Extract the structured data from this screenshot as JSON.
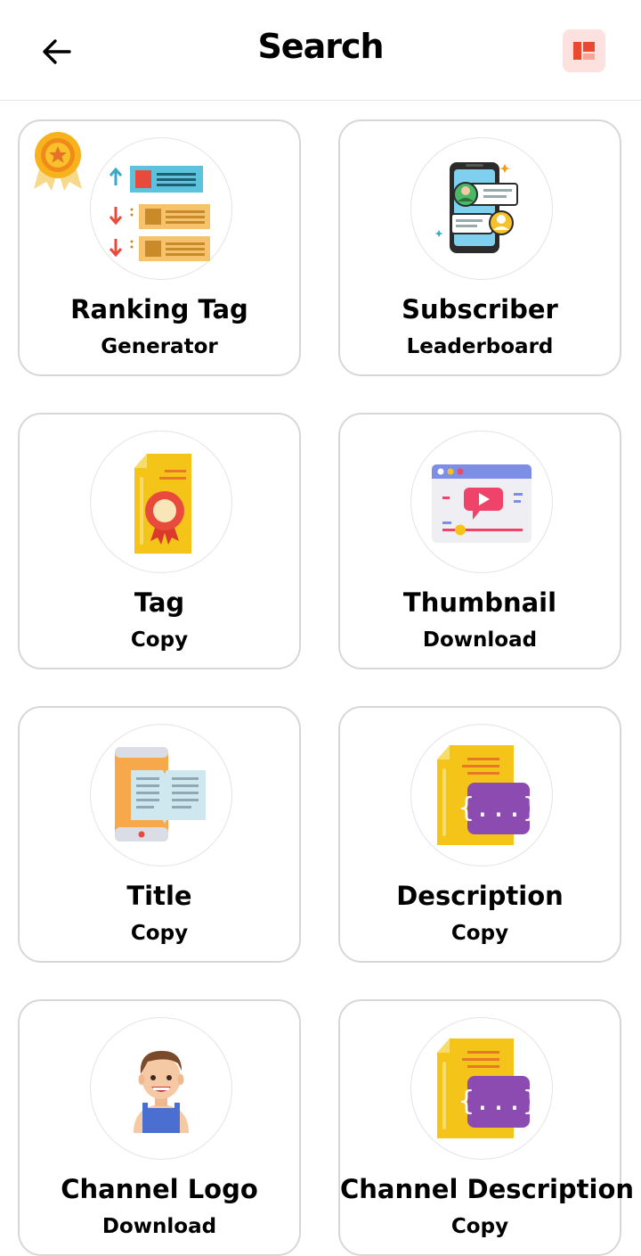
{
  "header": {
    "title": "Search",
    "back_icon": "arrow-left-icon",
    "menu_icon": "layout-icon",
    "menu_color": "#fde1de"
  },
  "cards": [
    {
      "title": "Ranking Tag",
      "subtitle": "Generator",
      "icon": "ranking-list-icon",
      "badge": "award-medal-icon"
    },
    {
      "title": "Subscriber",
      "subtitle": "Leaderboard",
      "icon": "phone-users-icon"
    },
    {
      "title": "Tag",
      "subtitle": "Copy",
      "icon": "certificate-icon"
    },
    {
      "title": "Thumbnail",
      "subtitle": "Download",
      "icon": "video-player-icon"
    },
    {
      "title": "Title",
      "subtitle": "Copy",
      "icon": "book-phone-icon"
    },
    {
      "title": "Description",
      "subtitle": "Copy",
      "icon": "code-file-icon"
    },
    {
      "title": "Channel Logo",
      "subtitle": "Download",
      "icon": "avatar-person-icon"
    },
    {
      "title": "Channel Description",
      "subtitle": "Copy",
      "icon": "code-file-icon"
    }
  ]
}
